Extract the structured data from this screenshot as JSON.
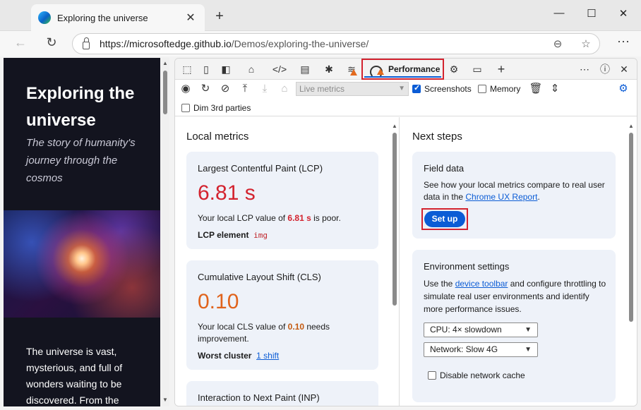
{
  "browser": {
    "tab_title": "Exploring the universe",
    "tab_close": "✕",
    "new_tab": "+",
    "minimize": "—",
    "maximize": "☐",
    "close": "✕",
    "url_host": "https://microsoftedge.github.io",
    "url_path": "/Demos/exploring-the-universe/",
    "back": "←",
    "refresh": "↻",
    "more": "⋯"
  },
  "webpage": {
    "title": "Exploring the universe",
    "subtitle": "The story of humanity's journey through the cosmos",
    "body": "The universe is vast, mysterious, and full of wonders waiting to be discovered. From the"
  },
  "devtools": {
    "active_tab": "Performance",
    "live_metrics_select": "Live metrics",
    "screenshots_label": "Screenshots",
    "screenshots_checked": true,
    "memory_label": "Memory",
    "memory_checked": false,
    "dim_3rd_parties_label": "Dim 3rd parties",
    "dim_3rd_parties_checked": false
  },
  "local_metrics": {
    "heading": "Local metrics",
    "lcp": {
      "title": "Largest Contentful Paint (LCP)",
      "value": "6.81 s",
      "desc_prefix": "Your local LCP value of ",
      "desc_value": "6.81 s",
      "desc_suffix": " is poor.",
      "element_label": "LCP element",
      "element_value": "img"
    },
    "cls": {
      "title": "Cumulative Layout Shift (CLS)",
      "value": "0.10",
      "desc_prefix": "Your local CLS value of ",
      "desc_value": "0.10",
      "desc_suffix": " needs improvement.",
      "cluster_label": "Worst cluster",
      "cluster_link": "1 shift"
    },
    "inp": {
      "title": "Interaction to Next Paint (INP)"
    }
  },
  "next_steps": {
    "heading": "Next steps",
    "field_data": {
      "title": "Field data",
      "desc": "See how your local metrics compare to real user data in the ",
      "link": "Chrome UX Report",
      "desc_end": ".",
      "button": "Set up"
    },
    "environment": {
      "title": "Environment settings",
      "desc_prefix": "Use the ",
      "link": "device toolbar",
      "desc_suffix": " and configure throttling to simulate real user environments and identify more performance issues.",
      "cpu_select": "CPU: 4× slowdown",
      "network_select": "Network: Slow 4G",
      "disable_cache_label": "Disable network cache",
      "disable_cache_checked": false
    }
  },
  "colors": {
    "poor": "#d3232f",
    "needs_improvement": "#e0631c",
    "accent": "#0b5cd5",
    "highlight_border": "#d3232f"
  }
}
